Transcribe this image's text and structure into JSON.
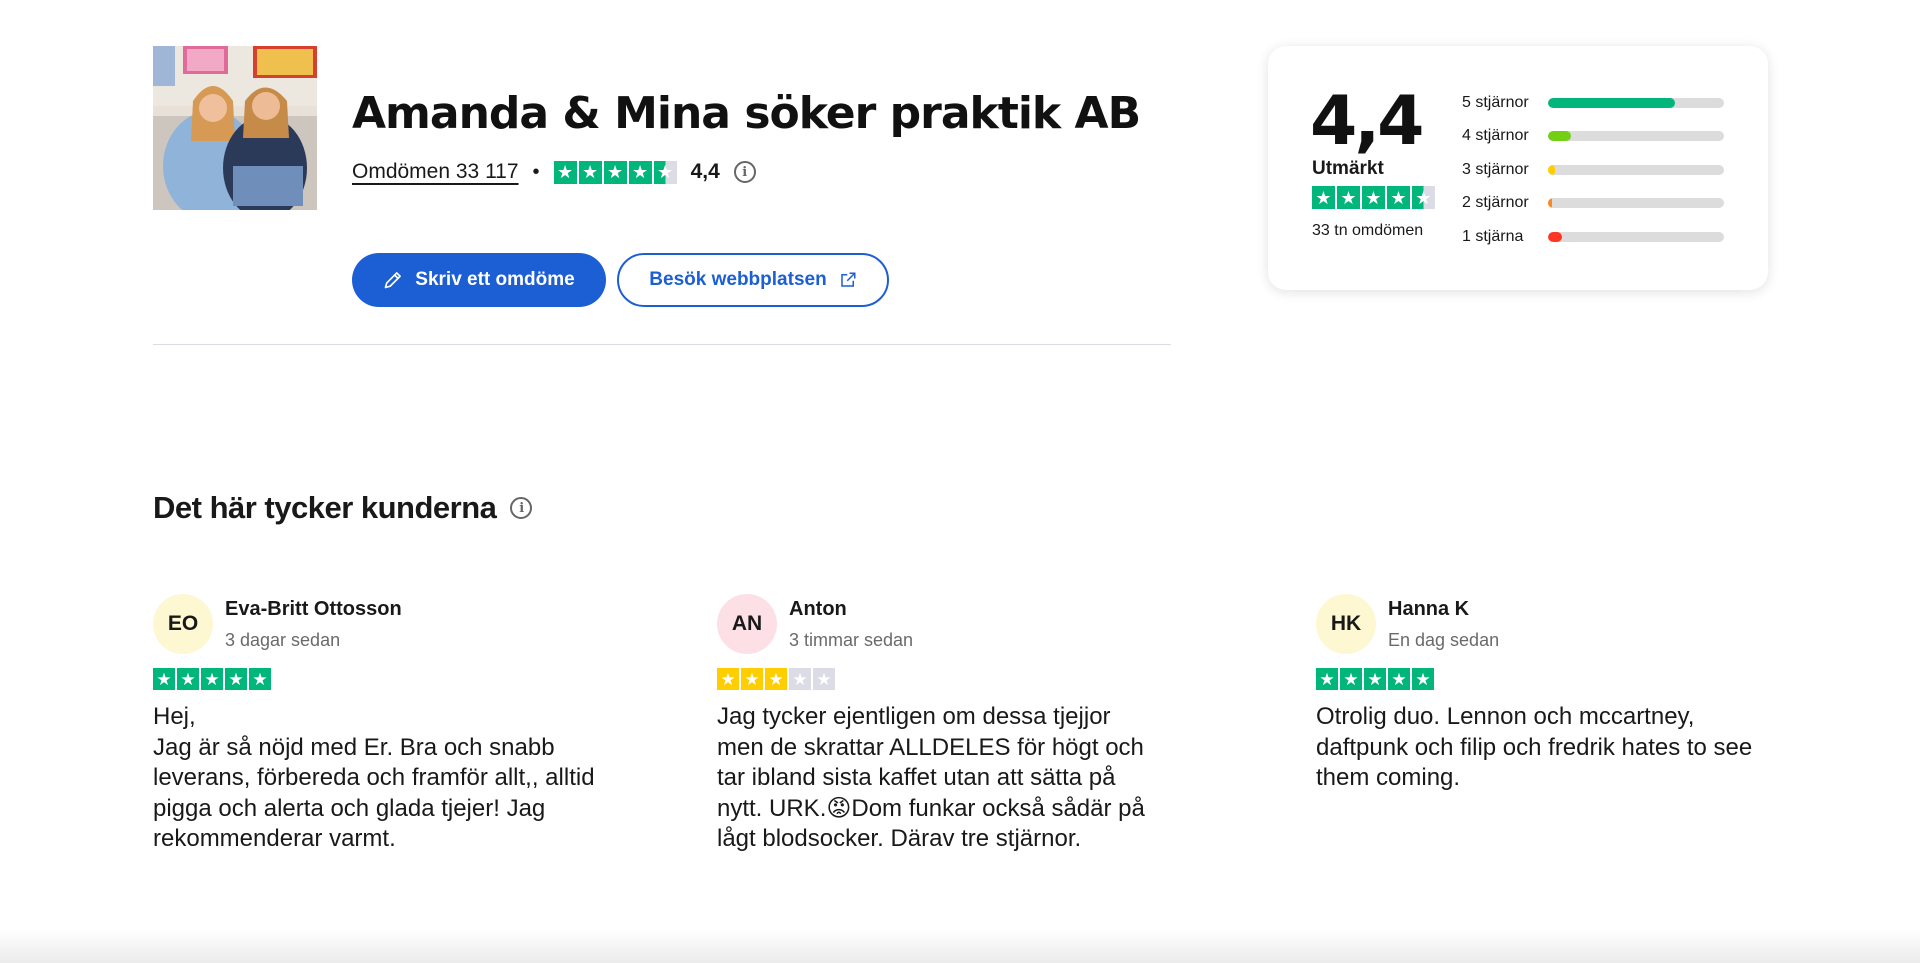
{
  "company": {
    "name": "Amanda & Mina söker praktik AB",
    "reviews_link": "Omdömen 33 117",
    "separator": "•",
    "rating": "4,4",
    "rating_fraction": 0.88,
    "photo_alt": "company-photo"
  },
  "buttons": {
    "write_review": "Skriv ett omdöme",
    "visit_website": "Besök webbplatsen"
  },
  "colors": {
    "accent": "#1c5ed4",
    "star_green": "#00b67a",
    "star_yellow": "#ffce00",
    "star_empty": "#dcdce6",
    "bar_5": "#00b67a",
    "bar_4": "#73cf11",
    "bar_3": "#ffce00",
    "bar_2": "#ff8622",
    "bar_1": "#ff3722"
  },
  "summary_card": {
    "score": "4,4",
    "label": "Utmärkt",
    "count": "33 tn omdömen",
    "distribution": [
      {
        "label": "5 stjärnor",
        "fraction": 0.72,
        "color": "#00b67a"
      },
      {
        "label": "4 stjärnor",
        "fraction": 0.13,
        "color": "#73cf11"
      },
      {
        "label": "3 stjärnor",
        "fraction": 0.04,
        "color": "#ffce00"
      },
      {
        "label": "2 stjärnor",
        "fraction": 0.025,
        "color": "#ff8622"
      },
      {
        "label": "1 stjärna",
        "fraction": 0.08,
        "color": "#ff3722"
      }
    ]
  },
  "section": {
    "title": "Det här tycker kunderna"
  },
  "reviews": [
    {
      "initials": "EO",
      "avatar_color": "#fdf7d2",
      "name": "Eva-Britt Ottosson",
      "time": "3 dagar sedan",
      "stars": 5,
      "text": "Hej,\nJag är så nöjd med Er. Bra och snabb\nleverans, förbereda och framför allt,, alltid\npigga och alerta och glada tjejer! Jag\nrekommenderar varmt."
    },
    {
      "initials": "AN",
      "avatar_color": "#fde0e6",
      "name": "Anton",
      "time": "3 timmar sedan",
      "stars": 3,
      "text": "Jag tycker ejentligen om dessa tjejjor\nmen de skrattar ALLDELES för högt och\ntar ibland sista kaffet utan att sätta på\nnytt. URK.😡Dom funkar också sådär på\nlågt blodsocker. Därav tre stjärnor."
    },
    {
      "initials": "HK",
      "avatar_color": "#fdf7d2",
      "name": "Hanna K",
      "time": "En dag sedan",
      "stars": 5,
      "text": "Otrolig duo. Lennon och mccartney,\ndaftpunk och filip och fredrik hates to see\nthem coming."
    }
  ],
  "icons": {
    "pencil": "pencil-icon",
    "external": "external-link-icon",
    "info": "info-icon",
    "star": "star-icon"
  }
}
